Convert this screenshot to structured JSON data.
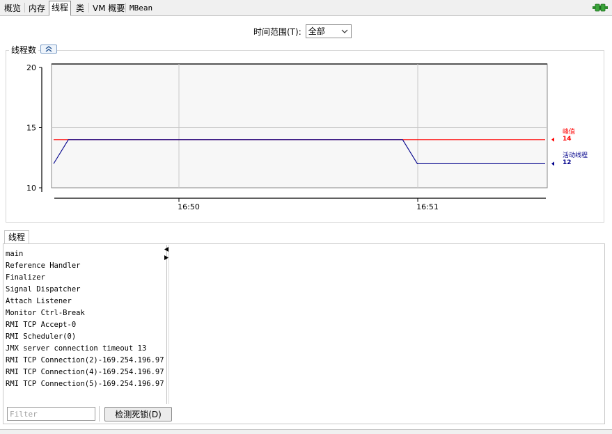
{
  "tabs": [
    {
      "label": "概览"
    },
    {
      "label": "内存"
    },
    {
      "label": "线程",
      "active": true
    },
    {
      "label": "类"
    },
    {
      "label": "VM 概要"
    },
    {
      "label": "MBean"
    }
  ],
  "connection_icon": "connection-plug-icon",
  "time_range": {
    "label": "时间范围(T):",
    "value": "全部"
  },
  "chart": {
    "title": "线程数",
    "collapse_icon": "double-chevron-up-icon"
  },
  "chart_data": {
    "type": "line",
    "x_ticks": [
      "16:50",
      "16:51"
    ],
    "y_ticks": [
      10,
      15,
      20
    ],
    "ylim": [
      10,
      20
    ],
    "grid": true,
    "series": [
      {
        "name": "峰值",
        "color": "#ff0000",
        "end_value": 14,
        "points": [
          [
            0.0,
            14
          ],
          [
            1.0,
            14
          ]
        ]
      },
      {
        "name": "活动线程",
        "color": "#00008b",
        "end_value": 12,
        "points": [
          [
            0.0,
            12
          ],
          [
            0.03,
            14
          ],
          [
            0.71,
            14
          ],
          [
            0.74,
            12
          ],
          [
            1.0,
            12
          ]
        ]
      }
    ]
  },
  "threads_section": {
    "tab_label": "线程",
    "threads": [
      "main",
      "Reference Handler",
      "Finalizer",
      "Signal Dispatcher",
      "Attach Listener",
      "Monitor Ctrl-Break",
      "RMI TCP Accept-0",
      "RMI Scheduler(0)",
      "JMX server connection timeout 13",
      "RMI TCP Connection(2)-169.254.196.97",
      "RMI TCP Connection(4)-169.254.196.97",
      "RMI TCP Connection(5)-169.254.196.97"
    ],
    "filter_placeholder": "Filter",
    "detect_deadlock_label": "检测死锁(D)"
  }
}
